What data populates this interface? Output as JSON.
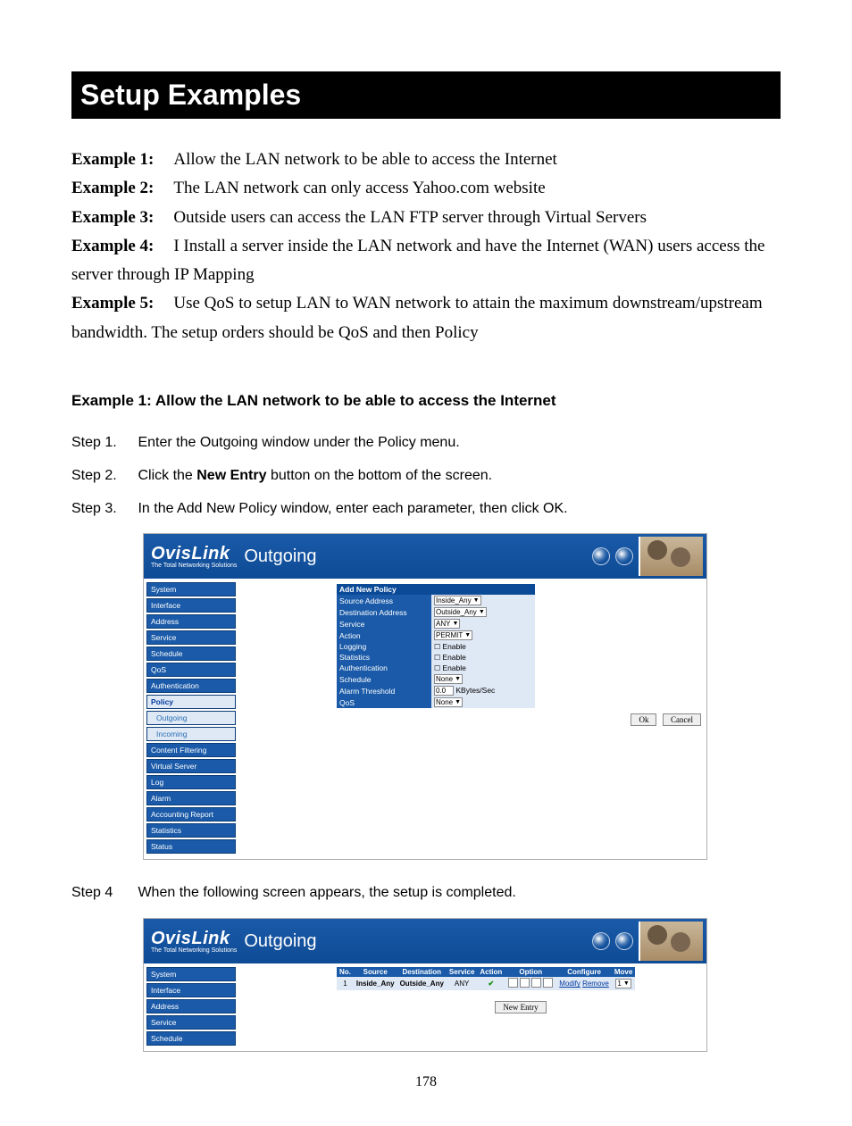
{
  "title": "Setup Examples",
  "examples": {
    "e1_label": "Example 1:",
    "e1_text": "Allow the LAN network to be able to access the Internet",
    "e2_label": "Example 2:",
    "e2_text": "The LAN network can only access Yahoo.com website",
    "e3_label": "Example 3:",
    "e3_text": "Outside users can access the LAN FTP server through Virtual Servers",
    "e4_label": "Example 4:",
    "e4_text": "I Install a server inside the LAN network and have the Internet (WAN) users access the server through IP Mapping",
    "e5_label": "Example 5:",
    "e5_text": "Use QoS to setup LAN to WAN network to attain the maximum downstream/upstream bandwidth. The setup orders should be QoS and then Policy"
  },
  "section1_heading": "Example 1:    Allow the LAN network to be able to access the Internet",
  "steps": {
    "s1_label": "Step 1.",
    "s1_text": "Enter the Outgoing window under the Policy menu.",
    "s2_label": "Step 2.",
    "s2_pre": "Click the ",
    "s2_bold": "New Entry",
    "s2_post": " button on the bottom of the screen.",
    "s3_label": "Step 3.",
    "s3_text": "In the Add New Policy window, enter each parameter, then click OK.",
    "s4_label": "Step 4",
    "s4_text": "When the following screen appears, the setup is completed."
  },
  "shot1": {
    "brand_name": "OvisLink",
    "brand_sub": "The Total Networking Solutions",
    "header_title": "Outgoing",
    "nav": {
      "i0": "System",
      "i1": "Interface",
      "i2": "Address",
      "i3": "Service",
      "i4": "Schedule",
      "i5": "QoS",
      "i6": "Authentication",
      "i7": "Policy",
      "i7a": "Outgoing",
      "i7b": "Incoming",
      "i8": "Content Filtering",
      "i9": "Virtual Server",
      "i10": "Log",
      "i11": "Alarm",
      "i12": "Accounting Report",
      "i13": "Statistics",
      "i14": "Status"
    },
    "form": {
      "heading": "Add New Policy",
      "r1k": "Source Address",
      "r1v": "Inside_Any",
      "r2k": "Destination Address",
      "r2v": "Outside_Any",
      "r3k": "Service",
      "r3v": "ANY",
      "r4k": "Action",
      "r4v": "PERMIT",
      "r5k": "Logging",
      "r5v": "Enable",
      "r6k": "Statistics",
      "r6v": "Enable",
      "r7k": "Authentication",
      "r7v": "Enable",
      "r8k": "Schedule",
      "r8v": "None",
      "r9k": "Alarm Threshold",
      "r9v": "0.0",
      "r9u": "KBytes/Sec",
      "r10k": "QoS",
      "r10v": "None",
      "ok": "Ok",
      "cancel": "Cancel"
    }
  },
  "shot2": {
    "brand_name": "OvisLink",
    "brand_sub": "The Total Networking Solutions",
    "header_title": "Outgoing",
    "nav": {
      "i0": "System",
      "i1": "Interface",
      "i2": "Address",
      "i3": "Service",
      "i4": "Schedule"
    },
    "table": {
      "h0": "No.",
      "h1": "Source",
      "h2": "Destination",
      "h3": "Service",
      "h4": "Action",
      "h5": "Option",
      "h6": "Configure",
      "h7": "Move",
      "r1_no": "1",
      "r1_src": "Inside_Any",
      "r1_dst": "Outside_Any",
      "r1_svc": "ANY",
      "r1_action_check": "✔",
      "r1_modify": "Modify",
      "r1_remove": "Remove",
      "r1_move": "1"
    },
    "new_entry": "New Entry"
  },
  "page_number": "178"
}
